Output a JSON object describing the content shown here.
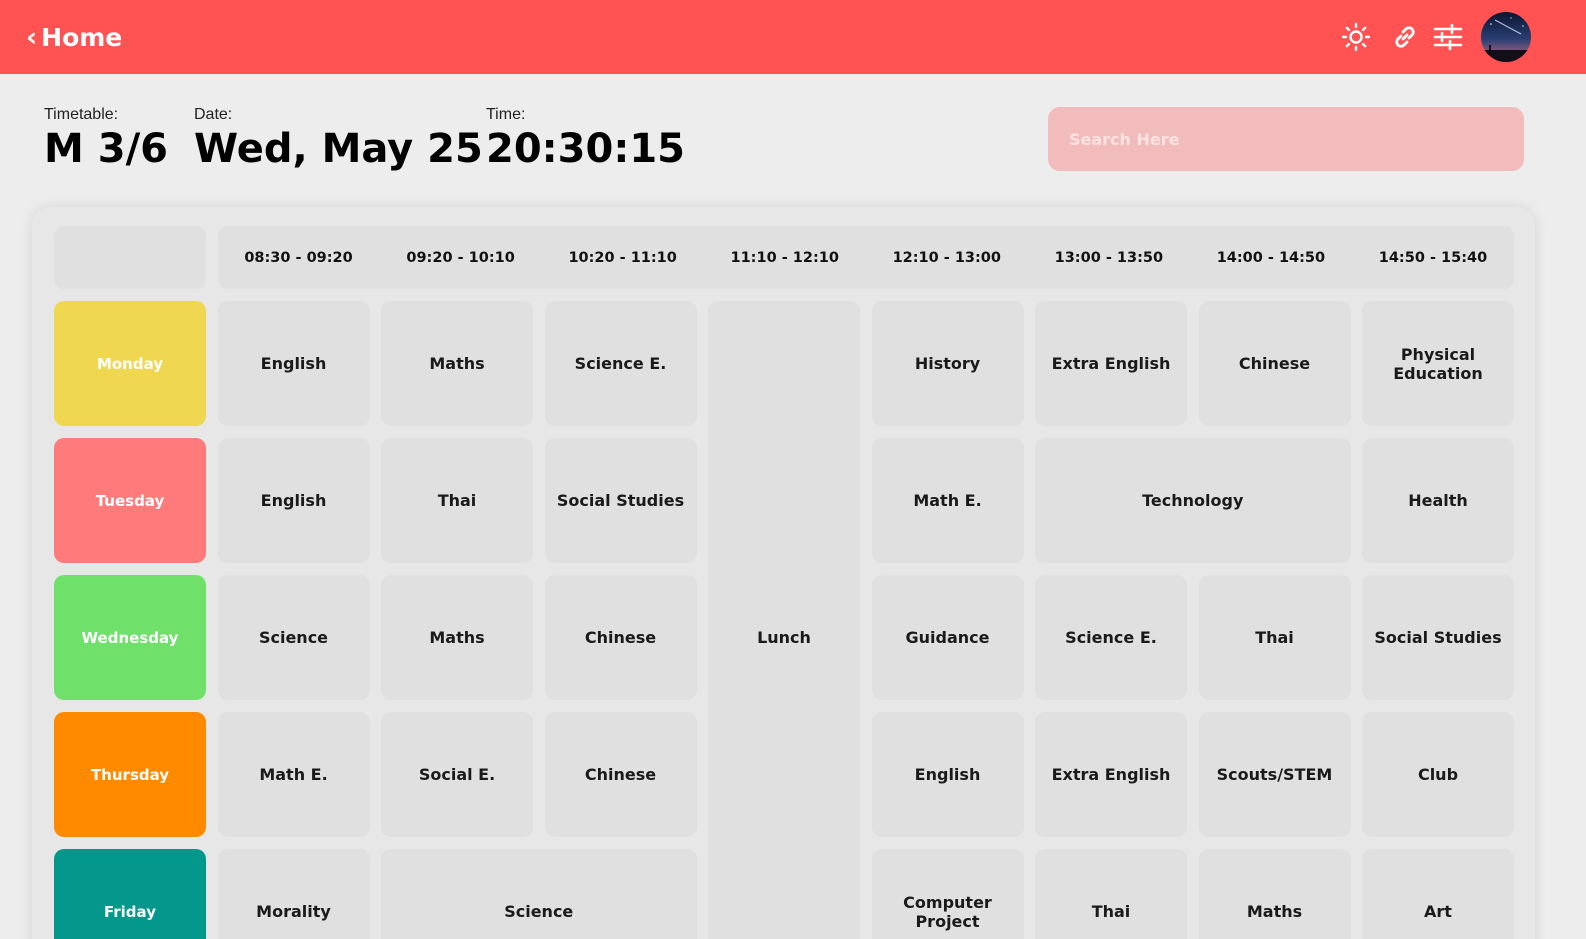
{
  "header": {
    "back_label": "Home",
    "back_chevron": "‹",
    "icons": [
      "sun-icon",
      "link-icon",
      "sliders-icon"
    ],
    "accent_color": "#ff5252"
  },
  "info": {
    "timetable_label": "Timetable:",
    "timetable_value": "M 3/6",
    "date_label": "Date:",
    "date_value": "Wed, May 25",
    "time_label": "Time:",
    "time_value": "20:30:15"
  },
  "search": {
    "placeholder": "Search Here",
    "value": ""
  },
  "timetable": {
    "periods": [
      "08:30 - 09:20",
      "09:20 - 10:10",
      "10:20 - 11:10",
      "11:10 - 12:10",
      "12:10 - 13:00",
      "13:00 - 13:50",
      "14:00 - 14:50",
      "14:50 - 15:40"
    ],
    "days": [
      {
        "name": "Monday",
        "color": "#f0d751"
      },
      {
        "name": "Tuesday",
        "color": "#ff7b7b"
      },
      {
        "name": "Wednesday",
        "color": "#6fe06a"
      },
      {
        "name": "Thursday",
        "color": "#ff8a00"
      },
      {
        "name": "Friday",
        "color": "#04988c"
      }
    ],
    "lunch_label": "Lunch",
    "monday": [
      "English",
      "Maths",
      "Science E.",
      "History",
      "Extra English",
      "Chinese",
      "Physical Education"
    ],
    "tuesday": [
      "English",
      "Thai",
      "Social Studies",
      "Math E.",
      "Technology",
      "Health"
    ],
    "wednesday": [
      "Science",
      "Maths",
      "Chinese",
      "Guidance",
      "Science E.",
      "Thai",
      "Social Studies"
    ],
    "thursday": [
      "Math E.",
      "Social E.",
      "Chinese",
      "English",
      "Extra English",
      "Scouts/STEM",
      "Club"
    ],
    "friday": [
      "Morality",
      "Science",
      "Computer Project",
      "Thai",
      "Maths",
      "Art"
    ]
  }
}
